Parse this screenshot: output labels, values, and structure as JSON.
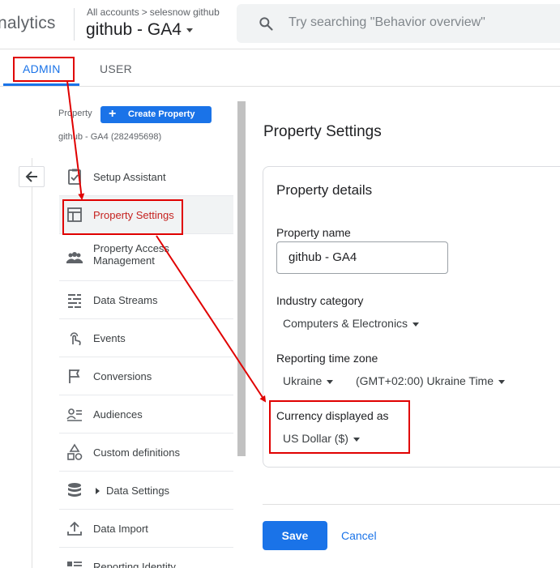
{
  "header": {
    "brand": "nalytics",
    "breadcrumb": {
      "all_accounts": "All accounts",
      "separator": ">",
      "account": "selesnow github"
    },
    "property_title": "github - GA4",
    "search_placeholder": "Try searching \"Behavior overview\""
  },
  "tabs": {
    "admin": "ADMIN",
    "user": "USER"
  },
  "property_panel": {
    "label": "Property",
    "create_button": "Create Property",
    "property_id": "github - GA4 (282495698)"
  },
  "nav": {
    "items": [
      {
        "label": "Setup Assistant",
        "icon": "clipboard-check-icon"
      },
      {
        "label": "Property Settings",
        "icon": "property-settings-icon",
        "active": true
      },
      {
        "label": "Property Access Management",
        "icon": "people-icon"
      },
      {
        "label": "Data Streams",
        "icon": "data-streams-icon"
      },
      {
        "label": "Events",
        "icon": "touch-icon"
      },
      {
        "label": "Conversions",
        "icon": "flag-icon"
      },
      {
        "label": "Audiences",
        "icon": "audience-icon"
      },
      {
        "label": "Custom definitions",
        "icon": "shapes-icon"
      },
      {
        "label": "Data Settings",
        "icon": "database-icon"
      },
      {
        "label": "Data Import",
        "icon": "upload-icon"
      },
      {
        "label": "Reporting Identity",
        "icon": "identity-icon"
      }
    ]
  },
  "main": {
    "title": "Property Settings",
    "card_title": "Property details",
    "property_name_label": "Property name",
    "property_name_value": "github - GA4",
    "industry_label": "Industry category",
    "industry_value": "Computers & Electronics",
    "timezone_label": "Reporting time zone",
    "timezone_country": "Ukraine",
    "timezone_value": "(GMT+02:00) Ukraine Time",
    "currency_label": "Currency displayed as",
    "currency_value": "US Dollar ($)",
    "save": "Save",
    "cancel": "Cancel"
  },
  "colors": {
    "accent": "#1a73e8",
    "annotation": "#e00000",
    "active_text": "#c5221f"
  }
}
